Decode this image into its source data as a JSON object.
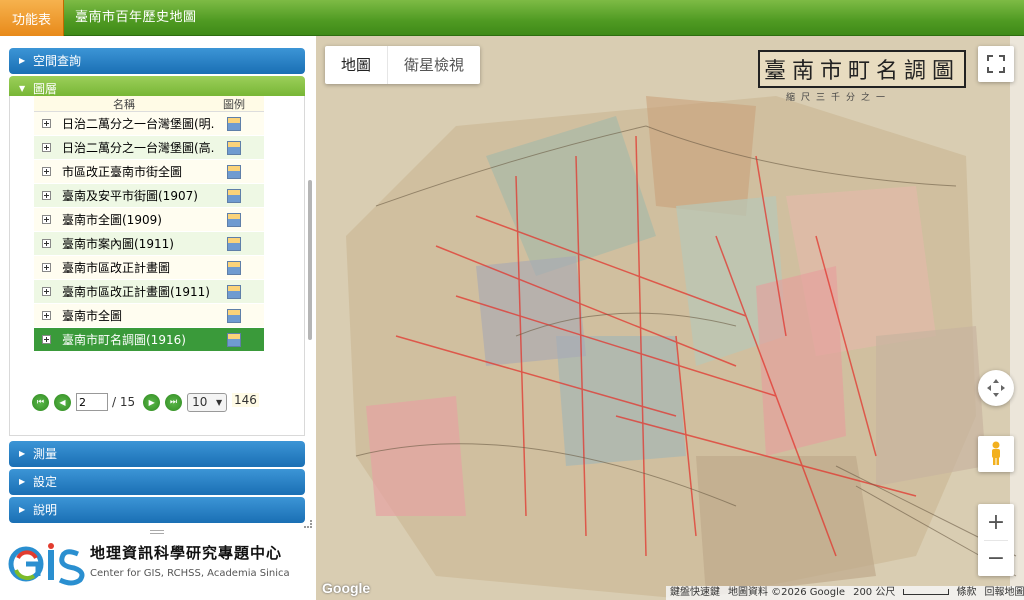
{
  "header": {
    "menu_label": "功能表",
    "title": "臺南市百年歷史地圖"
  },
  "sidebar": {
    "panels": {
      "spatial_query": "空間查詢",
      "layers": "圖層",
      "measure": "測量",
      "settings": "設定",
      "help": "說明"
    },
    "layer_table": {
      "col_name": "名稱",
      "col_legend": "圖例",
      "rows": [
        {
          "name": "日治二萬分之一台灣堡圖(明..."
        },
        {
          "name": "日治二萬分之一台灣堡圖(高..."
        },
        {
          "name": "市區改正臺南市街全圖"
        },
        {
          "name": "臺南及安平市街圖(1907)"
        },
        {
          "name": "臺南市全圖(1909)"
        },
        {
          "name": "臺南市案內圖(1911)"
        },
        {
          "name": "臺南市區改正計畫圖"
        },
        {
          "name": "臺南市區改正計畫圖(1911)"
        },
        {
          "name": "臺南市全圖"
        },
        {
          "name": "臺南市町名調圖(1916)"
        }
      ]
    },
    "pager": {
      "current_page": "2",
      "total_pages": "/ 15",
      "page_size": "10",
      "total_count": "146"
    },
    "logo": {
      "name_cn": "地理資訊科學研究專題中心",
      "name_en": "Center for GIS, RCHSS, Academia Sinica",
      "mark_text": "GIS"
    }
  },
  "map": {
    "type_controls": {
      "map": "地圖",
      "satellite": "衛星檢視"
    },
    "map_sheet_title": "臺南市町名調圖",
    "map_sheet_sub": "縮尺三千分之一",
    "attribution": {
      "google": "Google",
      "shortcuts": "鍵盤快速鍵",
      "data": "地圖資料 ©2026 Google",
      "scale": "200 公尺",
      "terms": "條款",
      "report": "回報地圖錯誤"
    }
  },
  "colors": {
    "accent_green": "#4f9a22",
    "menu_orange": "#e88a1a",
    "panel_blue": "#1a6fb4",
    "selected_row": "#3a9a3a"
  }
}
